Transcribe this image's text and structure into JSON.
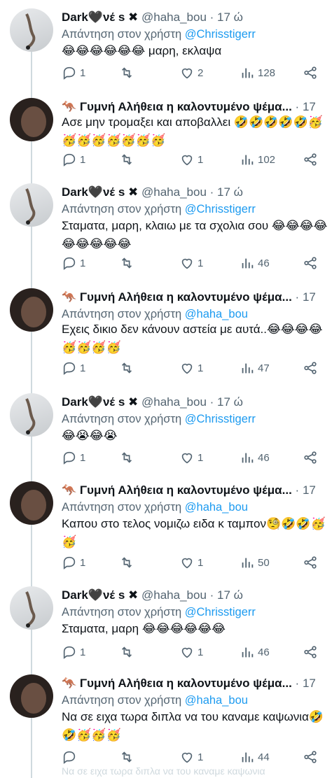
{
  "tweets": [
    {
      "author": "Dark🖤νέ s",
      "verified_x": "✖",
      "handle": "@haha_bou",
      "time": "17 ώ",
      "reply_prefix": "Απάντηση στον χρήστη",
      "reply_to": "@Chrisstigerr",
      "text": "😂😂😂😂😂😂 μαρη, εκλαψα",
      "replies": "1",
      "retweets": "",
      "likes": "2",
      "views": "128"
    },
    {
      "author": "Γυμνή Αλήθεια η καλοντυμένο ψέμα...",
      "flag": "🦘",
      "handle": "",
      "time": "17 ώ",
      "reply_prefix": "",
      "reply_to": "",
      "text": "Ασε μην τρομαξει και αποβαλλει 🤣🤣🤣🤣🤣🥳🥳🥳🥳🥳🥳🥳🥳",
      "replies": "1",
      "retweets": "",
      "likes": "1",
      "views": "102"
    },
    {
      "author": "Dark🖤νέ s",
      "verified_x": "✖",
      "handle": "@haha_bou",
      "time": "17 ώ",
      "reply_prefix": "Απάντηση στον χρήστη",
      "reply_to": "@Chrisstigerr",
      "text": "Σταματα, μαρη, κλαιω με τα σχολια σου 😂😂😂😂😂😂😂😂😂",
      "replies": "1",
      "retweets": "",
      "likes": "1",
      "views": "46"
    },
    {
      "author": "Γυμνή Αλήθεια η καλοντυμένο ψέμα...",
      "flag": "🦘",
      "handle": "",
      "time": "17 ώ",
      "reply_prefix": "Απάντηση στον χρήστη",
      "reply_to": "@haha_bou",
      "text": "Εχεις δικιο δεν κάνουν αστεία με αυτά..😂😂😂😂🥳🥳🥳🥳",
      "replies": "1",
      "retweets": "",
      "likes": "1",
      "views": "47"
    },
    {
      "author": "Dark🖤νέ s",
      "verified_x": "✖",
      "handle": "@haha_bou",
      "time": "17 ώ",
      "reply_prefix": "Απάντηση στον χρήστη",
      "reply_to": "@Chrisstigerr",
      "text": "😂😭😂😭",
      "replies": "1",
      "retweets": "",
      "likes": "1",
      "views": "46"
    },
    {
      "author": "Γυμνή Αλήθεια η καλοντυμένο ψέμα...",
      "flag": "🦘",
      "handle": "",
      "time": "17 ώ",
      "reply_prefix": "Απάντηση στον χρήστη",
      "reply_to": "@haha_bou",
      "text": "Καπου στο τελος νομιζω ειδα κ ταμπον🧐🤣🤣🥳🥳",
      "replies": "1",
      "retweets": "",
      "likes": "1",
      "views": "50"
    },
    {
      "author": "Dark🖤νέ s",
      "verified_x": "✖",
      "handle": "@haha_bou",
      "time": "17 ώ",
      "reply_prefix": "Απάντηση στον χρήστη",
      "reply_to": "@Chrisstigerr",
      "text": "Σταματα, μαρη 😂😂😂😂😂😂",
      "replies": "1",
      "retweets": "",
      "likes": "1",
      "views": "46"
    },
    {
      "author": "Γυμνή Αλήθεια η καλοντυμένο ψέμα...",
      "flag": "🦘",
      "handle": "",
      "time": "17 ώ",
      "reply_prefix": "Απάντηση στον χρήστη",
      "reply_to": "@haha_bou",
      "text": "Να σε ειχα τωρα διπλα να του καναμε καψωνια🤣🤣🥳🥳🥳",
      "replies": "",
      "retweets": "",
      "likes": "1",
      "views": "44"
    }
  ],
  "ghost_text": "Να σε ειχα τωρα διπλα να του καναμε καψωνια",
  "colors": {
    "accent": "#1d9bf0",
    "muted": "#536471",
    "line": "#cfd9de"
  },
  "icons": {
    "reply": "reply-icon",
    "retweet": "retweet-icon",
    "like": "heart-icon",
    "views": "views-icon",
    "share": "share-icon",
    "more": "more-icon"
  }
}
